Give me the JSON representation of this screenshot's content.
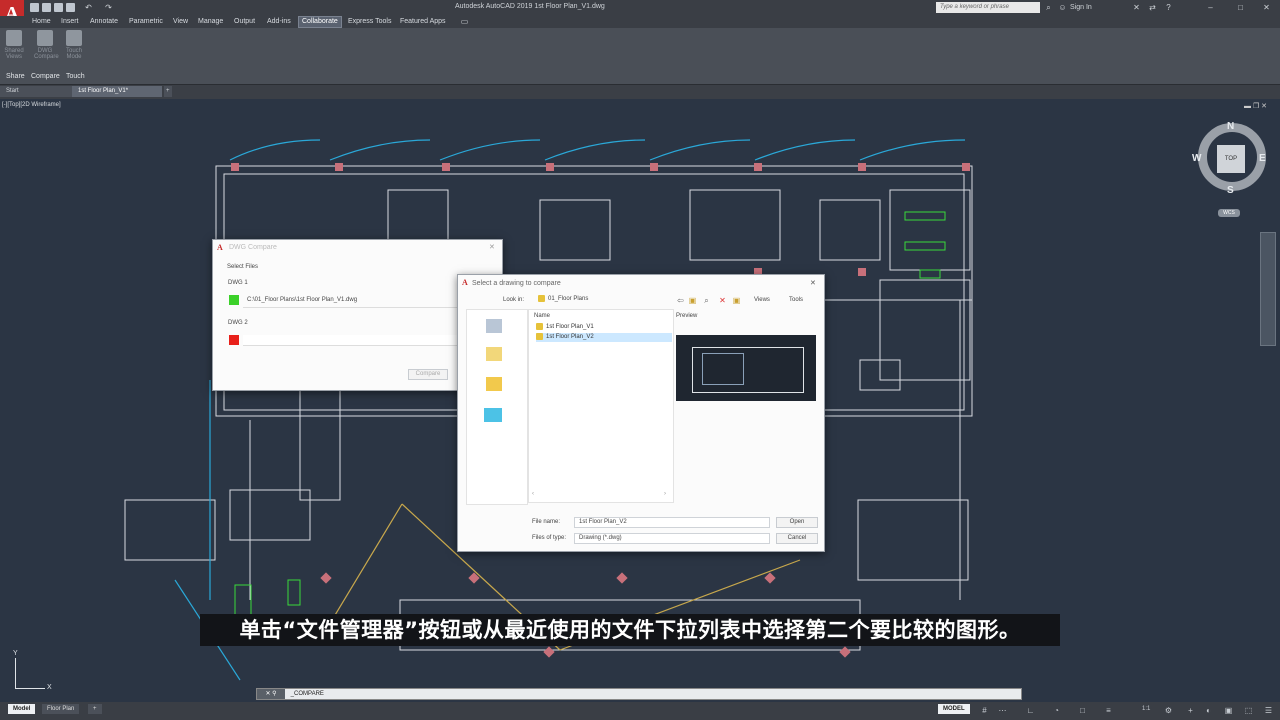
{
  "window": {
    "app_button": "A",
    "title": "Autodesk AutoCAD 2019    1st Floor Plan_V1.dwg",
    "search_placeholder": "Type a keyword or phrase",
    "sign_in": "Sign In"
  },
  "ribbon": {
    "tabs": [
      "Home",
      "Insert",
      "Annotate",
      "Parametric",
      "View",
      "Manage",
      "Output",
      "Add-ins",
      "Collaborate",
      "Express Tools",
      "Featured Apps"
    ],
    "active_tab": "Collaborate",
    "buttons": [
      {
        "label": "Shared Views",
        "icon": "shared-views-icon"
      },
      {
        "label": "DWG Compare",
        "icon": "dwg-compare-icon"
      },
      {
        "label": "Touch Mode",
        "icon": "touch-mode-icon"
      }
    ],
    "panels": [
      "Share",
      "Compare",
      "Touch"
    ]
  },
  "doc_tabs": {
    "tabs": [
      "Start",
      "1st Floor Plan_V1*"
    ],
    "active": "1st Floor Plan_V1*",
    "add_icon": "+"
  },
  "viewport": {
    "label": "[-][Top][2D Wireframe]",
    "compass": {
      "n": "N",
      "s": "S",
      "e": "E",
      "w": "W",
      "cube": "TOP",
      "wcs": "WCS"
    },
    "ucs": {
      "y": "Y",
      "x": "X"
    }
  },
  "compare_dialog": {
    "title": "DWG Compare",
    "select_files": "Select Files",
    "dwg1_label": "DWG 1",
    "dwg1_path": "C:\\01_Floor Plans\\1st Floor Plan_V1.dwg",
    "dwg1_color": "#3cd12a",
    "dwg2_label": "DWG 2",
    "dwg2_path": "",
    "dwg2_color": "#e8201a",
    "compare_button": "Compare"
  },
  "select_dialog": {
    "title": "Select a drawing to compare",
    "look_in_label": "Look in:",
    "look_in_value": "01_Floor Plans",
    "views_label": "Views",
    "tools_label": "Tools",
    "name_header": "Name",
    "preview_header": "Preview",
    "files": [
      "1st Floor Plan_V1",
      "1st Floor Plan_V2"
    ],
    "selected_file": "1st Floor Plan_V2",
    "file_name_label": "File name:",
    "file_name_value": "1st Floor Plan_V2",
    "files_of_type_label": "Files of type:",
    "files_of_type_value": "Drawing (*.dwg)",
    "open_button": "Open",
    "cancel_button": "Cancel"
  },
  "subtitle": "单击“文件管理器”按钮或从最近使用的文件下拉列表中选择第二个要比较的图形。",
  "command_line": {
    "text": "_COMPARE"
  },
  "status_bar": {
    "layout_tabs": [
      "Model",
      "Floor Plan"
    ],
    "active_layout": "Model",
    "model_label": "MODEL",
    "scale": "1:1"
  }
}
